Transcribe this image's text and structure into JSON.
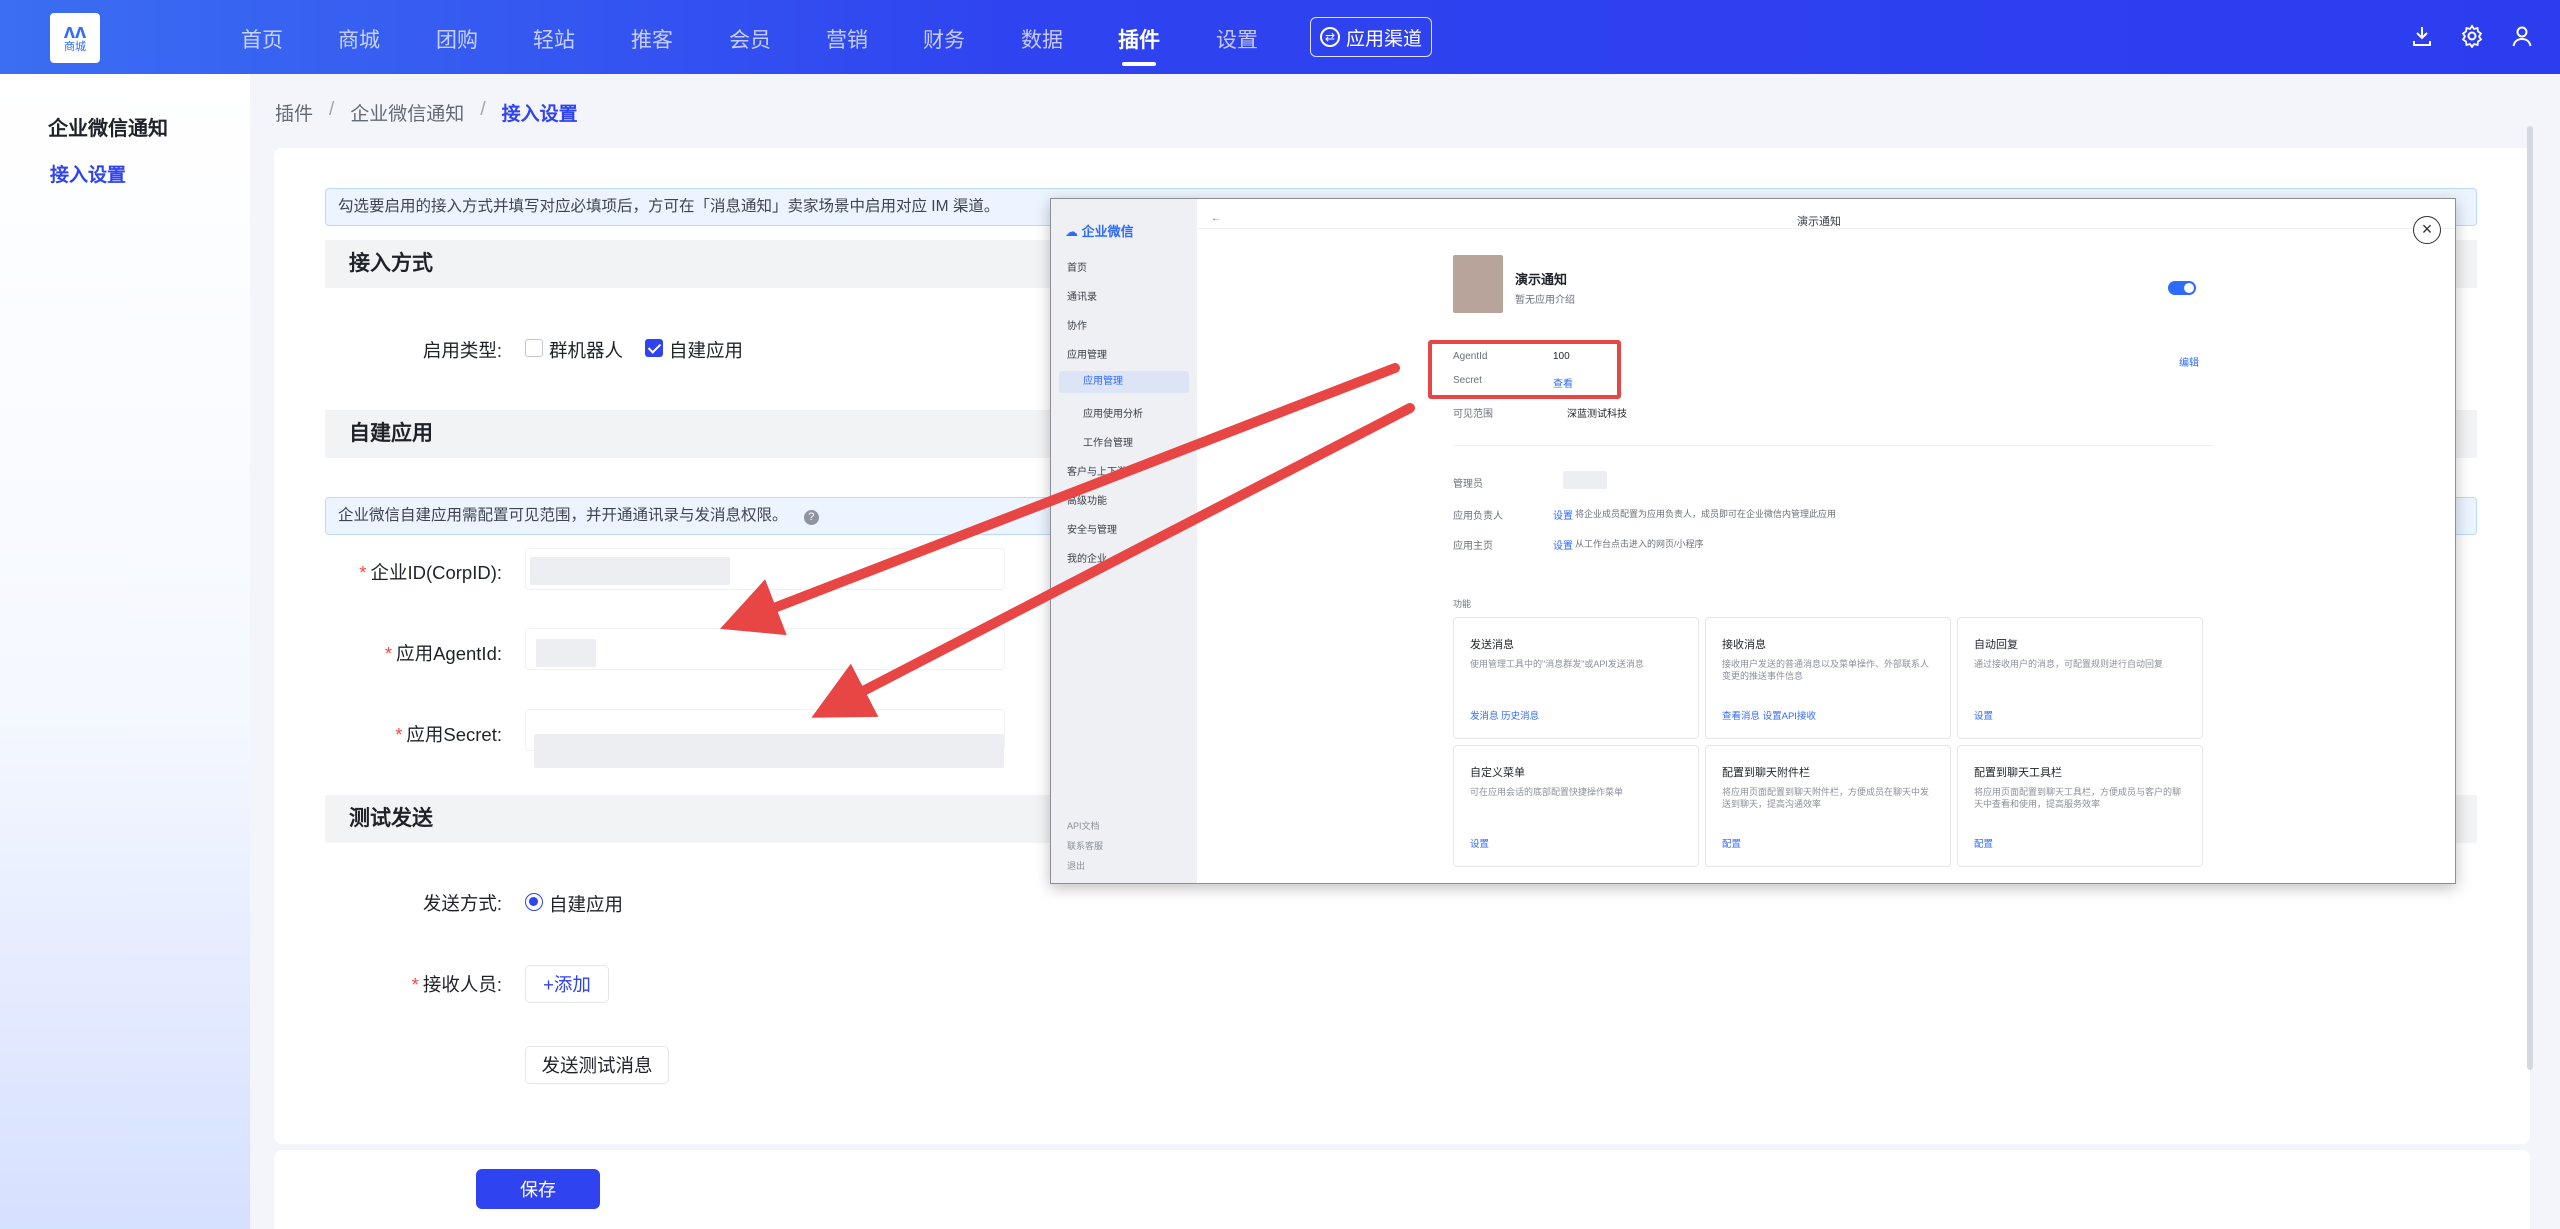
{
  "nav": {
    "logo_mark": "ʌʌ",
    "logo_text": "商城",
    "items": [
      {
        "label": "首页"
      },
      {
        "label": "商城"
      },
      {
        "label": "团购"
      },
      {
        "label": "轻站"
      },
      {
        "label": "推客"
      },
      {
        "label": "会员"
      },
      {
        "label": "营销"
      },
      {
        "label": "财务"
      },
      {
        "label": "数据"
      },
      {
        "label": "插件"
      },
      {
        "label": "设置"
      }
    ],
    "active": "插件",
    "channel_button": "应用渠道",
    "icons": [
      "download-icon",
      "gear-icon",
      "user-icon"
    ]
  },
  "sidebar": {
    "title": "企业微信通知",
    "items": [
      {
        "label": "接入设置"
      }
    ]
  },
  "breadcrumb": [
    "插件",
    "企业微信通知",
    "接入设置"
  ],
  "notice_top": "勾选要启用的接入方式并填写对应必填项后，方可在「消息通知」卖家场景中启用对应 IM 渠道。",
  "sections": {
    "access": "接入方式",
    "custom_app": "自建应用",
    "test": "测试发送"
  },
  "form": {
    "enable_type_label": "启用类型:",
    "options": [
      {
        "label": "群机器人",
        "checked": false
      },
      {
        "label": "自建应用",
        "checked": true
      }
    ],
    "app_notice": "企业微信自建应用需配置可见范围，并开通通讯录与发消息权限。",
    "corp_id_label": "企业ID(CorpID):",
    "agent_id_label": "应用AgentId:",
    "secret_label": "应用Secret:",
    "send_mode_label": "发送方式:",
    "send_mode_value": "自建应用",
    "receiver_label": "接收人员:",
    "add_button": "+添加",
    "send_test_button": "发送测试消息",
    "save_button": "保存"
  },
  "overlay": {
    "brand": "企业微信",
    "menu": [
      "首页",
      "通讯录",
      "协作",
      "应用管理",
      "应用管理",
      "应用使用分析",
      "工作台管理",
      "客户与上下游",
      "高级功能",
      "安全与管理",
      "我的企业"
    ],
    "footer_links": [
      "API文档",
      "联系客服",
      "退出"
    ],
    "title": "演示通知",
    "app_name": "演示通知",
    "app_desc": "暂无应用介绍",
    "agentid_label": "AgentId",
    "agentid_value": "100",
    "secret_label": "Secret",
    "secret_link": "查看",
    "visible_label": "可见范围",
    "visible_value": "深蓝测试科技",
    "edit_link": "编辑",
    "admin_label": "管理员",
    "owner_label": "应用负责人",
    "owner_link": "设置",
    "owner_desc": "将企业成员配置为应用负责人，成员即可在企业微信内管理此应用",
    "home_label": "应用主页",
    "home_link": "设置",
    "home_desc": "从工作台点击进入的网页/小程序",
    "func_label": "功能",
    "tiles": [
      {
        "title": "发送消息",
        "desc": "使用管理工具中的\"消息群发\"或API发送消息",
        "links": "发消息   历史消息"
      },
      {
        "title": "接收消息",
        "desc": "接收用户发送的普通消息以及菜单操作、外部联系人变更的推送事件信息",
        "links": "查看消息   设置API接收"
      },
      {
        "title": "自动回复",
        "desc": "通过接收用户的消息，可配置规则进行自动回复",
        "links": "设置"
      },
      {
        "title": "自定义菜单",
        "desc": "可在应用会话的底部配置快捷操作菜单",
        "links": "设置"
      },
      {
        "title": "配置到聊天附件栏",
        "desc": "将应用页面配置到聊天附件栏，方便成员在聊天中发送到聊天，提高沟通效率",
        "links": "配置"
      },
      {
        "title": "配置到聊天工具栏",
        "desc": "将应用页面配置到聊天工具栏，方便成员与客户的聊天中查看和使用，提高服务效率",
        "links": "配置"
      }
    ]
  }
}
